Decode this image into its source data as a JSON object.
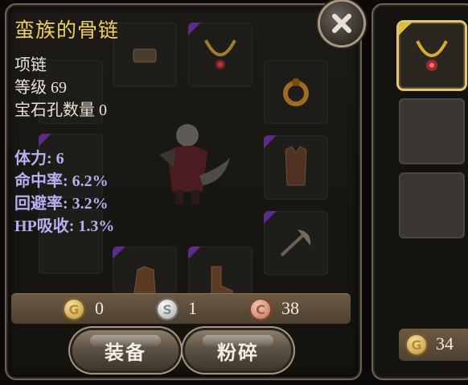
{
  "item": {
    "name": "蛮族的骨链",
    "type": "项链",
    "level": "等级 69",
    "gem_slots": "宝石孔数量 0",
    "stats": [
      "体力: 6",
      "命中率: 6.2%",
      "回避率: 3.2%",
      "HP吸收: 1.3%"
    ]
  },
  "currency": {
    "gold": "0",
    "silver": "1",
    "copper": "38",
    "gold_icon": "G",
    "silver_icon": "S",
    "copper_icon": "C"
  },
  "buttons": {
    "equip": "装备",
    "smash": "粉碎"
  },
  "side": {
    "gold": "34",
    "gold_icon": "G"
  },
  "colors": {
    "title": "#f0d060",
    "stat": "#b9aef0",
    "text": "#e8e3d8",
    "highlight": "#e6c771"
  }
}
